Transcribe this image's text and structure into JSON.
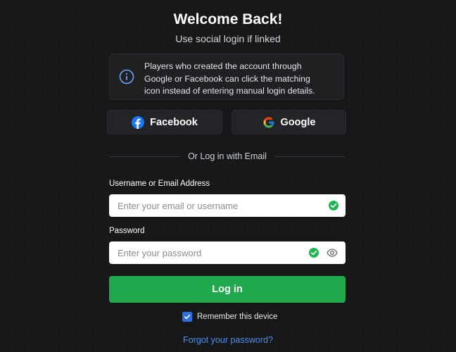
{
  "header": {
    "title": "Welcome Back!",
    "subtitle": "Use social login if linked"
  },
  "info": {
    "icon": "info-icon",
    "line1": "Players who created the account through",
    "line2": "Google or Facebook can click the matching",
    "line3": "icon instead of entering manual login details."
  },
  "social": {
    "facebook_label": "Facebook",
    "google_label": "Google"
  },
  "divider_text": "Or Log in with Email",
  "form": {
    "username_label": "Username or Email Address",
    "username_placeholder": "Enter your email or username",
    "username_value": "",
    "password_label": "Password",
    "password_placeholder": "Enter your password",
    "password_value": "",
    "login_label": "Log in",
    "remember_label": "Remember this device",
    "remember_checked": true,
    "forgot_label": "Forgot your password?"
  },
  "colors": {
    "background": "#161718",
    "accent_green": "#1fa84c",
    "link_blue": "#4a8ff0",
    "checkbox_blue": "#2d6fe0",
    "facebook_blue": "#1877f2",
    "valid_green": "#22b455"
  }
}
